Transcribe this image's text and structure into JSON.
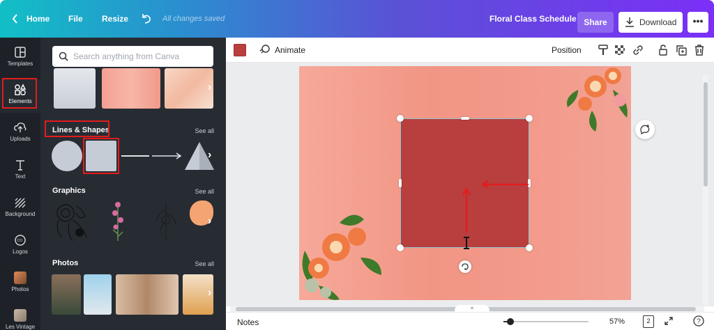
{
  "topbar": {
    "home": "Home",
    "file": "File",
    "resize": "Resize",
    "saved_status": "All changes saved",
    "design_title": "Floral Class Schedule",
    "share": "Share",
    "download": "Download",
    "more": "•••"
  },
  "rail": {
    "items": [
      {
        "label": "Templates",
        "icon": "templates-icon"
      },
      {
        "label": "Elements",
        "icon": "elements-icon"
      },
      {
        "label": "Uploads",
        "icon": "uploads-icon"
      },
      {
        "label": "Text",
        "icon": "text-icon"
      },
      {
        "label": "Background",
        "icon": "background-icon"
      },
      {
        "label": "Logos",
        "icon": "logos-icon"
      },
      {
        "label": "Photos",
        "icon": "photos-icon"
      },
      {
        "label": "Les Vintage",
        "icon": "folder-icon"
      }
    ]
  },
  "panel": {
    "search_placeholder": "Search anything from Canva",
    "sections": {
      "lines_shapes": "Lines & Shapes",
      "graphics": "Graphics",
      "photos": "Photos",
      "see_all": "See all"
    }
  },
  "editor": {
    "animate": "Animate",
    "position": "Position",
    "fill_color": "#b93e3e"
  },
  "bottom": {
    "notes": "Notes",
    "zoom": "57%",
    "page_count": "2",
    "zoom_level": 0.57
  },
  "colors": {
    "accent_red": "#e31c1c",
    "shape_fill": "#b93e3e",
    "panel_bg": "#272c33",
    "rail_bg": "#1e2228"
  }
}
